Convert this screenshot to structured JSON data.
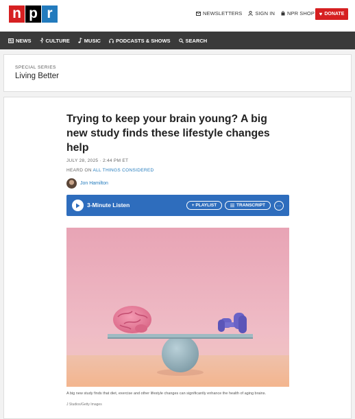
{
  "header": {
    "logo_letters": [
      "n",
      "p",
      "r"
    ],
    "links": [
      {
        "label": "NEWSLETTERS",
        "icon": "mail-icon"
      },
      {
        "label": "SIGN IN",
        "icon": "user-icon"
      },
      {
        "label": "NPR SHOP",
        "icon": "bag-icon"
      }
    ],
    "donate_label": "DONATE",
    "donate_color": "#d62021"
  },
  "nav": {
    "items": [
      {
        "label": "NEWS",
        "icon": "newspaper-icon"
      },
      {
        "label": "CULTURE",
        "icon": "culture-icon"
      },
      {
        "label": "MUSIC",
        "icon": "music-note-icon"
      },
      {
        "label": "PODCASTS & SHOWS",
        "icon": "headphones-icon"
      },
      {
        "label": "SEARCH",
        "icon": "search-icon"
      }
    ]
  },
  "series": {
    "kicker": "SPECIAL SERIES",
    "title": "Living Better"
  },
  "article": {
    "headline": "Trying to keep your brain young? A big new study finds these lifestyle changes help",
    "date": "JULY 28, 2025 · 2:44 PM ET",
    "heard_prefix": "HEARD ON ",
    "heard_show": "ALL THINGS CONSIDERED",
    "author": "Jon Hamilton"
  },
  "player": {
    "listen_label": "3-Minute Listen",
    "playlist_label": "+ PLAYLIST",
    "transcript_label": "TRANSCRIPT",
    "more_label": "···",
    "color": "#2e6dbd"
  },
  "image": {
    "caption": "A big new study finds that diet, exercise and other lifestyle changes can significantly enhance the health of aging brains.",
    "credit": "J Studios/Getty Images"
  }
}
